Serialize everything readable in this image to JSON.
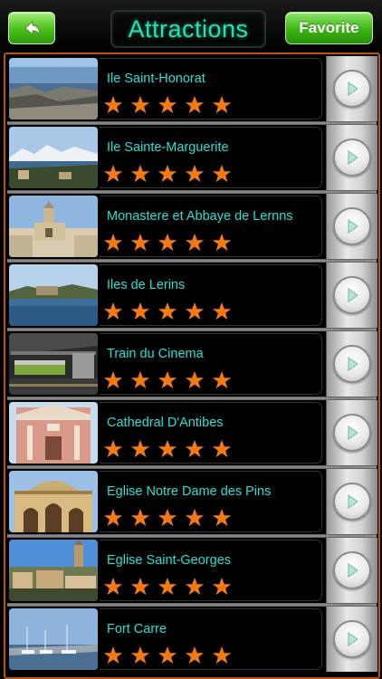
{
  "header": {
    "back_icon": "back-arrow-icon",
    "title": "Attractions",
    "favorite_label": "Favorite"
  },
  "colors": {
    "accent_green": "#3cb414",
    "title_teal": "#25e0b0",
    "item_text": "#24e1d2",
    "star_orange": "#f57a14",
    "frame_orange": "#b95414"
  },
  "list": {
    "items": [
      {
        "name": "Ile Saint-Honorat",
        "rating": 5,
        "thumb": "coast-rocks"
      },
      {
        "name": "Ile Sainte-Marguerite",
        "rating": 5,
        "thumb": "sea-mountains"
      },
      {
        "name": "Monastere et Abbaye de Lernns",
        "rating": 5,
        "thumb": "abbey-tower"
      },
      {
        "name": "Iles de Lerins",
        "rating": 5,
        "thumb": "island-sea"
      },
      {
        "name": "Train du Cinema",
        "rating": 5,
        "thumb": "train-station"
      },
      {
        "name": "Cathedral D'Antibes",
        "rating": 5,
        "thumb": "cathedral-facade"
      },
      {
        "name": "Eglise Notre Dame des Pins",
        "rating": 5,
        "thumb": "church-arches"
      },
      {
        "name": "Eglise Saint-Georges",
        "rating": 5,
        "thumb": "church-town"
      },
      {
        "name": "Fort Carre",
        "rating": 5,
        "thumb": "harbor-boats"
      }
    ]
  }
}
